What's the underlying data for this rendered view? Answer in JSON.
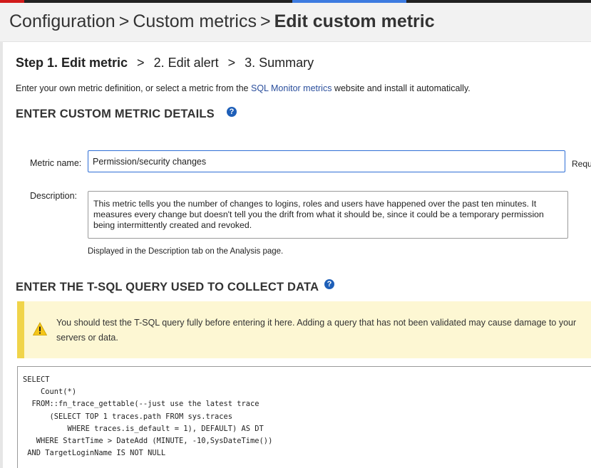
{
  "header": {
    "crumb1": "Configuration",
    "crumb2": "Custom metrics",
    "crumb3": "Edit custom metric",
    "separator": ">"
  },
  "steps": {
    "step1": "Step 1. Edit metric",
    "step2": "2. Edit alert",
    "step3": "3. Summary",
    "separator": ">"
  },
  "intro": {
    "before": "Enter your own metric definition, or select a metric from the ",
    "link": "SQL Monitor metrics",
    "after": " website and install it automatically."
  },
  "section1": {
    "title": "ENTER CUSTOM METRIC DETAILS",
    "help_icon": "question-circle-icon"
  },
  "metric_name": {
    "label": "Metric name:",
    "value": "Permission/security changes",
    "required_text": "Requ"
  },
  "description": {
    "label": "Description:",
    "value": "This metric tells you the number of changes to logins, roles and users have happened over the past ten  minutes. It measures every change but doesn't tell you the drift from what it should be, since it could be a temporary permission being intermittently created and revoked.",
    "hint": "Displayed in the Description tab on the Analysis page."
  },
  "section2": {
    "title": "ENTER THE T-SQL QUERY USED TO COLLECT DATA",
    "help_icon": "question-circle-icon"
  },
  "warning": {
    "icon": "warning-triangle-icon",
    "text": "You should test the T-SQL query fully before entering it here. Adding a query that has not been validated may cause damage to your servers or data."
  },
  "sql_query": "SELECT\n    Count(*)\n  FROM::fn_trace_gettable(--just use the latest trace\n      (SELECT TOP 1 traces.path FROM sys.traces\n          WHERE traces.is_default = 1), DEFAULT) AS DT\n   WHERE StartTime > DateAdd (MINUTE, -10,SysDateTime())\n AND TargetLoginName IS NOT NULL",
  "colors": {
    "accent": "#2f6fd6",
    "help_icon": "#1e5fb8",
    "warning_bg": "#fdf7d3",
    "warning_stripe": "#f0d44a",
    "link": "#2a4e9c"
  }
}
